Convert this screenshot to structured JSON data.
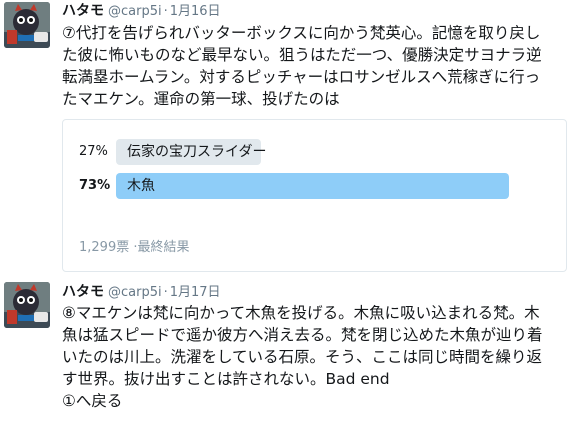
{
  "colors": {
    "winning_bar": "#8ecdf8",
    "losing_bar": "#e1e8ed",
    "meta_text": "#8899a6",
    "handle_text": "#657786"
  },
  "tweets": [
    {
      "avatar_icon": "mascot-avatar-icon",
      "name": "ハタモ",
      "handle": "@carp5i",
      "separator": "·",
      "date": "1月16日",
      "text_lines": [
        "⑦代打を告げられバッターボックスに向かう梵英心。記憶を取り戻し",
        "た彼に怖いものなど最早ない。狙うはただ一つ、優勝決定サヨナラ逆",
        "転満塁ホームラン。対するピッチャーはロサンゼルスへ荒稼ぎに行っ",
        "たマエケン。運命の第一球、投げたのは"
      ],
      "poll": {
        "options": [
          {
            "percent_label": "27%",
            "percent": 27,
            "label": "伝家の宝刀スライダー",
            "winner": false
          },
          {
            "percent_label": "73%",
            "percent": 73,
            "label": "木魚",
            "winner": true
          }
        ],
        "votes": "1,299票",
        "meta_separator": "·",
        "status": "最終結果"
      }
    },
    {
      "avatar_icon": "mascot-avatar-icon",
      "name": "ハタモ",
      "handle": "@carp5i",
      "separator": "·",
      "date": "1月17日",
      "text_lines": [
        "⑧マエケンは梵に向かって木魚を投げる。木魚に吸い込まれる梵。木",
        "魚は猛スピードで遥か彼方へ消え去る。梵を閉じ込めた木魚が辿り着",
        "いたのは川上。洗濯をしている石原。そう、ここは同じ時間を繰り返",
        "す世界。抜け出すことは許されない。Bad end",
        "①へ戻る"
      ]
    }
  ]
}
